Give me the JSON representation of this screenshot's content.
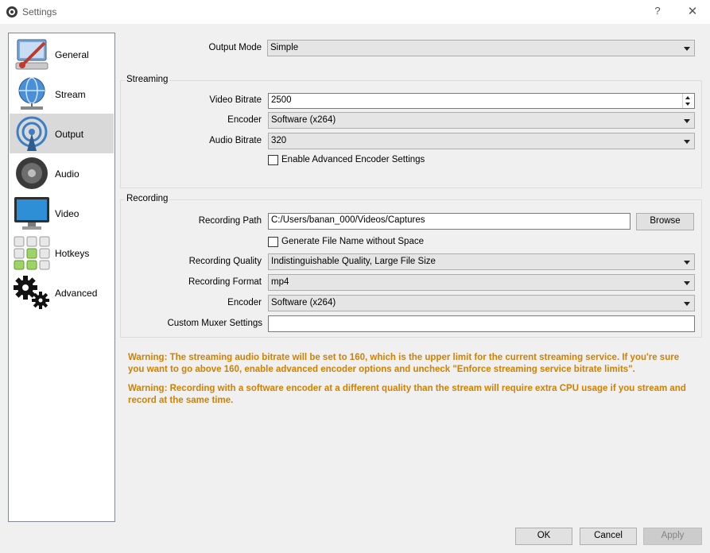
{
  "window": {
    "title": "Settings",
    "help_glyph": "?",
    "close_glyph": "✕"
  },
  "sidebar": {
    "items": [
      {
        "label": "General",
        "icon": "general-icon"
      },
      {
        "label": "Stream",
        "icon": "stream-icon"
      },
      {
        "label": "Output",
        "icon": "output-icon",
        "selected": true
      },
      {
        "label": "Audio",
        "icon": "audio-icon"
      },
      {
        "label": "Video",
        "icon": "video-icon"
      },
      {
        "label": "Hotkeys",
        "icon": "hotkeys-icon"
      },
      {
        "label": "Advanced",
        "icon": "advanced-icon"
      }
    ]
  },
  "output_mode": {
    "label": "Output Mode",
    "value": "Simple"
  },
  "streaming": {
    "title": "Streaming",
    "video_bitrate": {
      "label": "Video Bitrate",
      "value": "2500"
    },
    "encoder": {
      "label": "Encoder",
      "value": "Software (x264)"
    },
    "audio_bitrate": {
      "label": "Audio Bitrate",
      "value": "320"
    },
    "advanced_encoder": {
      "label": "Enable Advanced Encoder Settings",
      "checked": false
    }
  },
  "recording": {
    "title": "Recording",
    "path": {
      "label": "Recording Path",
      "value": "C:/Users/banan_000/Videos/Captures",
      "browse_label": "Browse"
    },
    "no_space": {
      "label": "Generate File Name without Space",
      "checked": false
    },
    "quality": {
      "label": "Recording Quality",
      "value": "Indistinguishable Quality, Large File Size"
    },
    "format": {
      "label": "Recording Format",
      "value": "mp4"
    },
    "encoder": {
      "label": "Encoder",
      "value": "Software (x264)"
    },
    "muxer": {
      "label": "Custom Muxer Settings",
      "value": ""
    }
  },
  "warnings": {
    "audio": "Warning: The streaming audio bitrate will be set to 160, which is the upper limit for the current streaming service.  If you're sure you want to go above 160, enable advanced encoder options and uncheck \"Enforce streaming service bitrate limits\".",
    "recording": "Warning: Recording with a software encoder at a different quality than the stream will require extra CPU usage if you stream and record at the same time."
  },
  "buttons": {
    "ok": "OK",
    "cancel": "Cancel",
    "apply": "Apply"
  },
  "colors": {
    "warning": "#d08100",
    "selected_item": "#d9d9d9",
    "window_bg": "#f0f0f0"
  }
}
